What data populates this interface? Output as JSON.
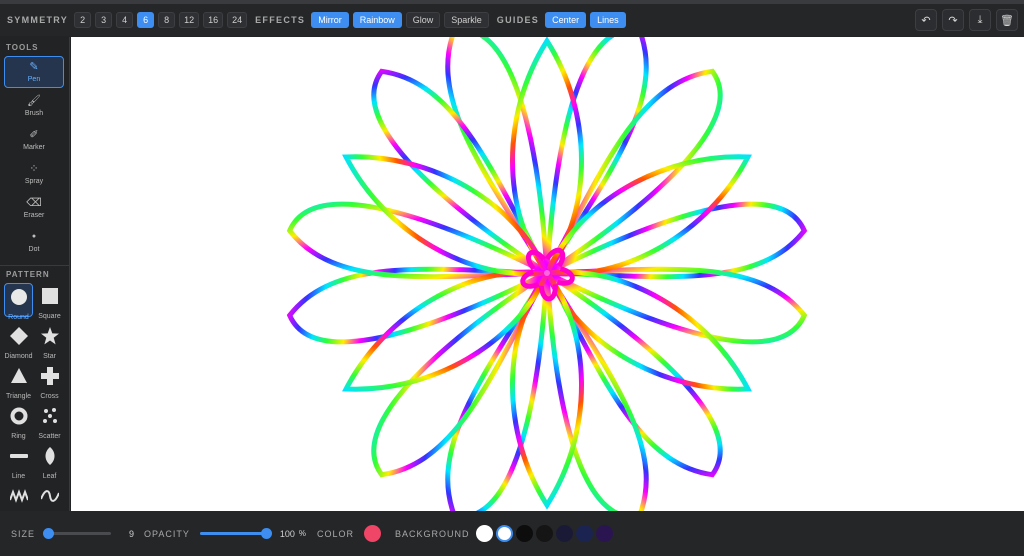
{
  "toolbar": {
    "symmetry_label": "SYMMETRY",
    "symmetry_options": [
      "2",
      "3",
      "4",
      "6",
      "8",
      "12",
      "16",
      "24"
    ],
    "symmetry_selected": "6",
    "effects_label": "EFFECTS",
    "effects": [
      {
        "label": "Mirror",
        "active": true
      },
      {
        "label": "Rainbow",
        "active": true
      },
      {
        "label": "Glow",
        "active": false
      },
      {
        "label": "Sparkle",
        "active": false
      }
    ],
    "guides_label": "GUIDES",
    "guides": [
      {
        "label": "Center",
        "active": true
      },
      {
        "label": "Lines",
        "active": true
      }
    ],
    "actions": [
      {
        "icon": "undo-icon",
        "glyph": "↶"
      },
      {
        "icon": "redo-icon",
        "glyph": "↷"
      },
      {
        "icon": "download-icon",
        "glyph": "⤓"
      },
      {
        "icon": "trash-icon",
        "glyph": "🗑"
      }
    ]
  },
  "sidebar": {
    "tools_label": "TOOLS",
    "tools": [
      {
        "label": "Pen",
        "icon": "pen-icon",
        "glyph": "✎",
        "active": true
      },
      {
        "label": "Brush",
        "icon": "brush-icon",
        "glyph": "🖌",
        "active": false
      },
      {
        "label": "Marker",
        "icon": "marker-icon",
        "glyph": "✐",
        "active": false
      },
      {
        "label": "Spray",
        "icon": "spray-icon",
        "glyph": "⁘",
        "active": false
      },
      {
        "label": "Eraser",
        "icon": "eraser-icon",
        "glyph": "⌫",
        "active": false
      },
      {
        "label": "Dot",
        "icon": "dot-icon",
        "glyph": "●",
        "active": false
      }
    ],
    "pattern_label": "PATTERN",
    "patterns": [
      {
        "label": "Round",
        "icon": "circle-icon",
        "active": true
      },
      {
        "label": "Square",
        "icon": "square-icon",
        "active": false
      },
      {
        "label": "Diamond",
        "icon": "diamond-icon",
        "active": false
      },
      {
        "label": "Star",
        "icon": "star-icon",
        "active": false
      },
      {
        "label": "Triangle",
        "icon": "triangle-icon",
        "active": false
      },
      {
        "label": "Cross",
        "icon": "cross-icon",
        "active": false
      },
      {
        "label": "Ring",
        "icon": "ring-icon",
        "active": false
      },
      {
        "label": "Scatter",
        "icon": "scatter-icon",
        "active": false
      },
      {
        "label": "Line",
        "icon": "line-icon",
        "active": false
      },
      {
        "label": "Leaf",
        "icon": "leaf-icon",
        "active": false
      },
      {
        "label": "",
        "icon": "zigzag-icon",
        "active": false
      },
      {
        "label": "",
        "icon": "wave-icon",
        "active": false
      }
    ]
  },
  "bottom": {
    "size_label": "SIZE",
    "size_value": "9",
    "size_fraction": 0.05,
    "opacity_label": "OPACITY",
    "opacity_value": "100",
    "opacity_unit": "%",
    "opacity_fraction": 1.0,
    "color_label": "COLOR",
    "color_value": "#ef4566",
    "background_label": "BACKGROUND",
    "background_swatches": [
      "#ffffff",
      "#ffffff",
      "#0d0d0d",
      "#151515",
      "#1a1a36",
      "#1b2450",
      "#2a1550"
    ],
    "background_selected_index": 1
  },
  "colors": {
    "accent": "#3d8ef0",
    "canvas_background": "#ffffff"
  },
  "canvas": {
    "symmetry_count": 6,
    "stroke_style": "rainbow"
  }
}
